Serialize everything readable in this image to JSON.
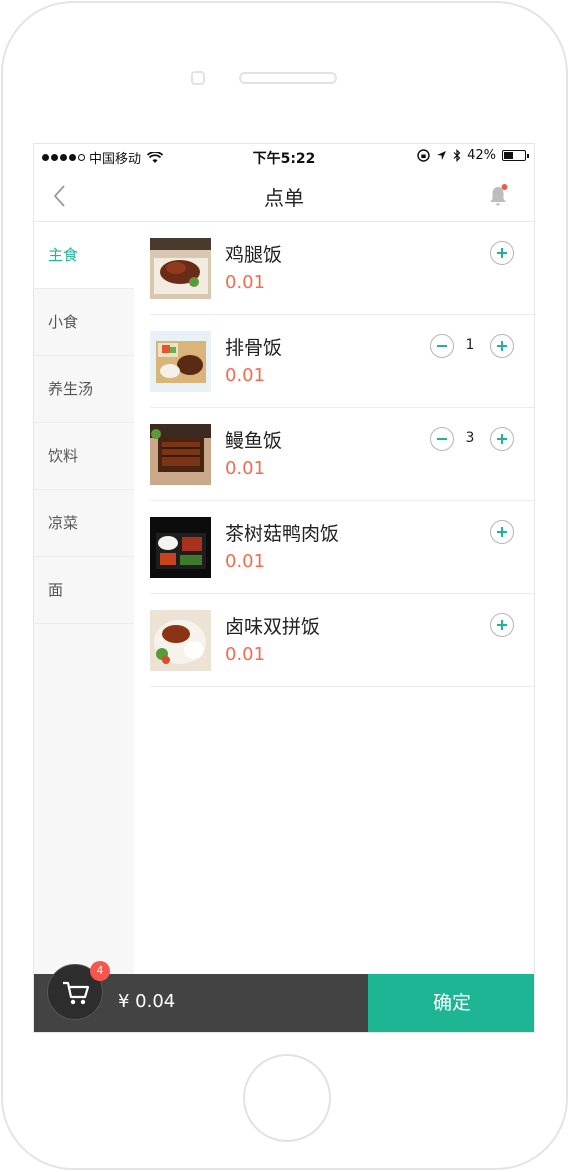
{
  "status": {
    "carrier": "中国移动",
    "time": "下午5:22",
    "battery": "42%",
    "battery_level": 0.42
  },
  "nav": {
    "title": "点单",
    "back_icon": "chevron-left-icon",
    "bell_icon": "bell-icon",
    "bell_has_notification": true
  },
  "categories": [
    {
      "label": "主食",
      "active": true
    },
    {
      "label": "小食"
    },
    {
      "label": "养生汤"
    },
    {
      "label": "饮料"
    },
    {
      "label": "凉菜"
    },
    {
      "label": "面"
    }
  ],
  "items": [
    {
      "name": "鸡腿饭",
      "price": "0.01",
      "qty": null
    },
    {
      "name": "排骨饭",
      "price": "0.01",
      "qty": "1"
    },
    {
      "name": "鳗鱼饭",
      "price": "0.01",
      "qty": "3"
    },
    {
      "name": "茶树菇鸭肉饭",
      "price": "0.01",
      "qty": null
    },
    {
      "name": "卤味双拼饭",
      "price": "0.01",
      "qty": null
    }
  ],
  "cart": {
    "count": "4",
    "total": "¥ 0.04",
    "confirm_label": "确定"
  },
  "colors": {
    "accent": "#1db594",
    "price": "#f46c50",
    "badge": "#f5574d",
    "bar": "#434343"
  }
}
